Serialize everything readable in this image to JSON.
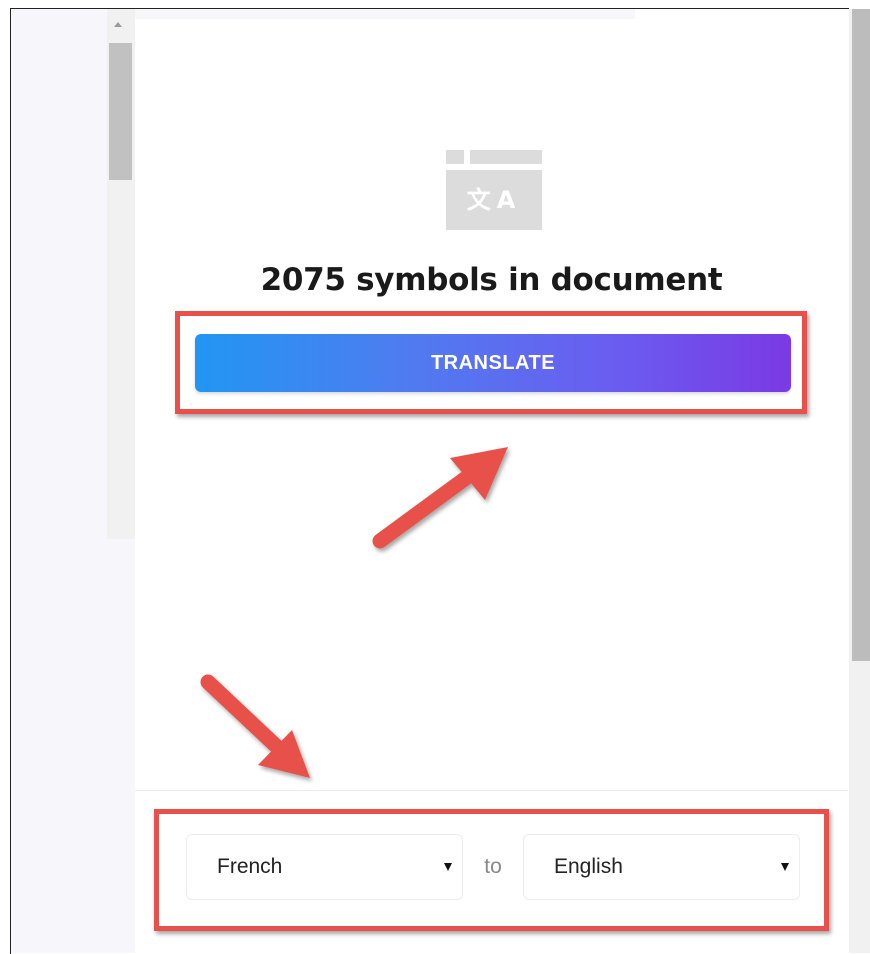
{
  "document": {
    "symbols_text": "2075 symbols in document",
    "icon": "translate-icon",
    "icon_glyphs": "文A"
  },
  "actions": {
    "translate_label": "TRANSLATE"
  },
  "language_selector": {
    "source": "French",
    "connector": "to",
    "target": "English"
  },
  "annotations": {
    "highlight_color": "#e8514a",
    "arrow_color": "#e8514a"
  },
  "colors": {
    "button_gradient_start": "#2196f3",
    "button_gradient_end": "#7b39e4"
  }
}
